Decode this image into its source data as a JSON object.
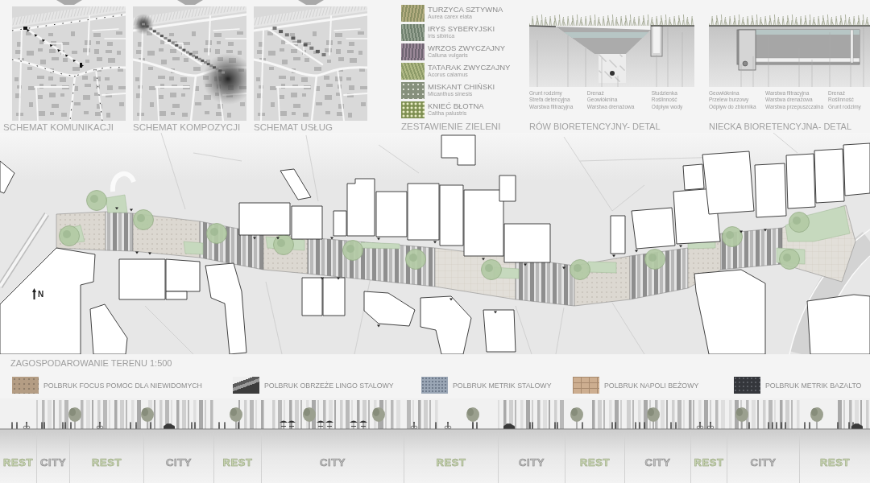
{
  "schemes": [
    {
      "caption": "SCHEMAT KOMUNIKACJI",
      "kind": "communication"
    },
    {
      "caption": "SCHEMAT KOMPOZYCJI",
      "kind": "composition"
    },
    {
      "caption": "SCHEMAT USŁUG",
      "kind": "services"
    }
  ],
  "greenery": {
    "plants": [
      {
        "name": "TURZYCA SZTYWNA",
        "latin": "Aurea carex elata"
      },
      {
        "name": "IRYS SYBERYJSKI",
        "latin": "Iris sibirica"
      },
      {
        "name": "WRZOS ZWYCZAJNY",
        "latin": "Calluna vulgaris"
      },
      {
        "name": "TATARAK ZWYCZAJNY",
        "latin": "Acorus calamus"
      },
      {
        "name": "MISKANT CHIŃSKI",
        "latin": "Micanthus sinesis"
      },
      {
        "name": "KNIEĆ BŁOTNA",
        "latin": "Caltha palustris"
      }
    ],
    "caption": "ZESTAWIENIE ZIELENI"
  },
  "details": [
    {
      "kind": "ditch",
      "label_columns": [
        [
          "Grunt rodzimy",
          "Strefa detencyjna",
          "Warstwa filtracyjna"
        ],
        [
          "Drenaż",
          "Geowłóknina",
          "Warstwa drenażowa"
        ],
        [
          "Studzienka",
          "Roślinność",
          "Odpływ wody"
        ]
      ],
      "caption": "RÓW BIORETENCYJNY- DETAL"
    },
    {
      "kind": "basin",
      "label_columns": [
        [
          "Geowłóknina",
          "Przelew burzowy",
          "Odpływ do zbiornika"
        ],
        [
          "Warstwa filtracyjna",
          "Warstwa drenażowa",
          "Warstwa przepuszczalna"
        ],
        [
          "Drenaż",
          "Roślinność",
          "Grunt rodzimy"
        ]
      ],
      "caption": "NIECKA BIORETENCYJNA- DETAL"
    }
  ],
  "site_plan": {
    "north_label": "N",
    "caption": "ZAGOSPODAROWANIE TERENU 1:500"
  },
  "materials": [
    "POLBRUK FOCUS POMOC DLA NIEWIDOMYCH",
    "POLBRUK OBRZEŻE LINGO STALOWY",
    "POLBRUK METRIK STALOWY",
    "POLBRUK NAPOLI BEŻOWY",
    "POLBRUK METRIK BAZALTO"
  ],
  "elevation": {
    "zones": [
      {
        "label": "REST",
        "kind": "rest"
      },
      {
        "label": "CITY",
        "kind": "city"
      },
      {
        "label": "REST",
        "kind": "rest"
      },
      {
        "label": "CITY",
        "kind": "city"
      },
      {
        "label": "REST",
        "kind": "rest"
      },
      {
        "label": "CITY",
        "kind": "city"
      },
      {
        "label": "REST",
        "kind": "rest"
      },
      {
        "label": "CITY",
        "kind": "city"
      },
      {
        "label": "REST",
        "kind": "rest"
      },
      {
        "label": "CITY",
        "kind": "city"
      },
      {
        "label": "REST",
        "kind": "rest"
      },
      {
        "label": "CITY",
        "kind": "city"
      },
      {
        "label": "REST",
        "kind": "rest"
      }
    ]
  }
}
